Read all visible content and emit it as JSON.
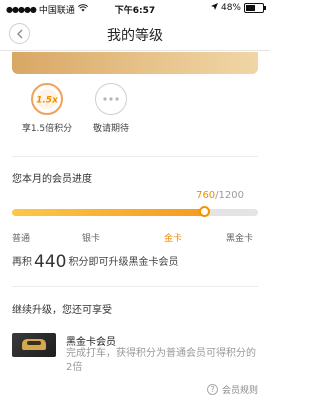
{
  "status_bar": {
    "carrier": "中国联通",
    "time": "下午6:57",
    "battery": "48%",
    "battery_level": 0.48
  },
  "nav": {
    "title": "我的等级",
    "back_icon": "chevron-left-icon"
  },
  "benefits": [
    {
      "badge": "1.5x",
      "label": "享1.5倍积分",
      "active": true
    },
    {
      "badge": "•••",
      "label": "敬请期待",
      "active": false
    }
  ],
  "progress": {
    "title": "您本月的会员进度",
    "current": "760",
    "separator": "/",
    "total": "1200",
    "fill_fraction": 0.785,
    "tiers": [
      "普通",
      "银卡",
      "金卡",
      "黑金卡"
    ],
    "active_tier": "金卡"
  },
  "upgrade": {
    "prefix": "再积",
    "points": "440",
    "suffix": "积分即可升级黑金卡会员"
  },
  "continue_section": {
    "title": "继续升级，您还可享受"
  },
  "next_card": {
    "title": "黑金卡会员",
    "description": "完成打车，获得积分为普通会员可得积分的2倍"
  },
  "footer": {
    "rules_label": "会员规则",
    "help_icon": "question-circle-icon"
  },
  "colors": {
    "accent": "#f29400",
    "banner": "#e8c58d",
    "muted": "#999999"
  }
}
